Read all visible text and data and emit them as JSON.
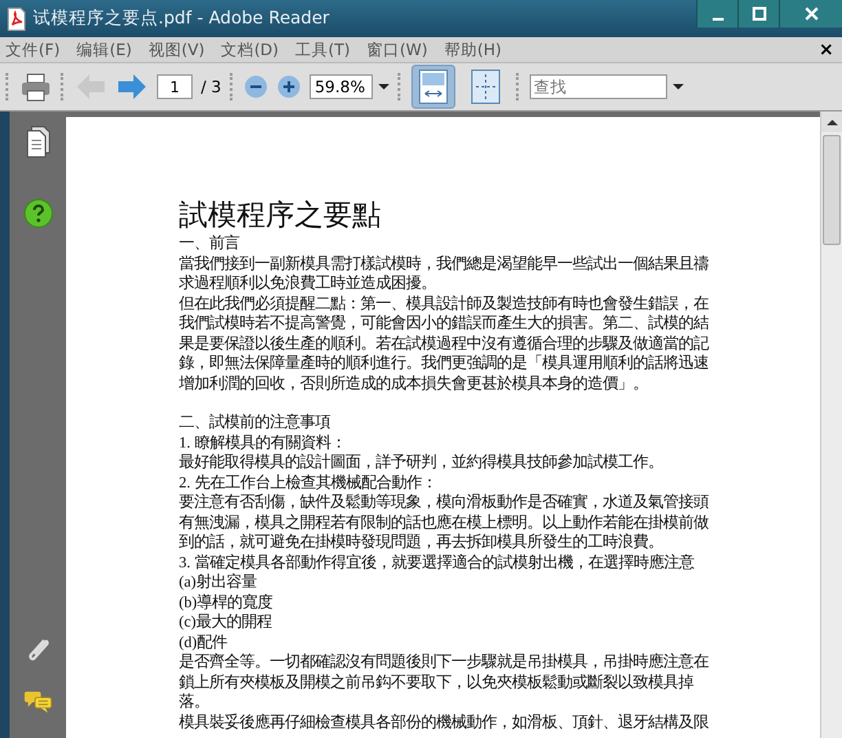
{
  "window": {
    "title": "试模程序之要点.pdf - Adobe Reader"
  },
  "menu": {
    "items": [
      "文件(F)",
      "编辑(E)",
      "视图(V)",
      "文档(D)",
      "工具(T)",
      "窗口(W)",
      "帮助(H)"
    ],
    "close": "×"
  },
  "toolbar": {
    "back_disabled": true,
    "page": "1",
    "page_total": "/ 3",
    "zoom": "59.8%",
    "view_buttons": [
      {
        "kind": "fit-width",
        "selected": true
      },
      {
        "kind": "fit-page",
        "selected": false
      }
    ],
    "search_placeholder": "查找"
  },
  "document": {
    "title": "試模程序之要點",
    "sections": [
      {
        "lines": [
          "一、前言",
          "當我們接到一副新模具需打樣試模時，我們總是渴望能早一些試出一個結果且禱",
          "求過程順利以免浪費工時並造成困擾。",
          "但在此我們必須提醒二點：第一、模具設計師及製造技師有時也會發生錯誤，在",
          "我們試模時若不提高警覺，可能會因小的錯誤而產生大的損害。第二、試模的結",
          "果是要保證以後生產的順利。若在試模過程中沒有遵循合理的步驟及做適當的記",
          "錄，即無法保障量產時的順利進行。我們更強調的是「模具運用順利的話將迅速",
          "增加利潤的回收，否則所造成的成本損失會更甚於模具本身的造價」。"
        ]
      },
      {
        "lines": [
          "二、試模前的注意事項",
          "1. 瞭解模具的有關資料：",
          "最好能取得模具的設計圖面，詳予研判，並約得模具技師參加試模工作。",
          "2. 先在工作台上檢查其機械配合動作：",
          "要注意有否刮傷，缺件及鬆動等現象，模向滑板動作是否確實，水道及氣管接頭",
          "有無洩漏，模具之開程若有限制的話也應在模上標明。以上動作若能在掛模前做",
          "到的話，就可避免在掛模時發現問題，再去拆卸模具所發生的工時浪費。",
          "3. 當確定模具各部動作得宜後，就要選擇適合的試模射出機，在選擇時應注意",
          "(a)射出容量",
          "(b)導桿的寬度",
          "(c)最大的開程",
          "(d)配件",
          "是否齊全等。一切都確認沒有問題後則下一步驟就是吊掛模具，吊掛時應注意在",
          "鎖上所有夾模板及開模之前吊鈎不要取下，以免夾模板鬆動或斷裂以致模具掉",
          "落。",
          "模具裝妥後應再仔細檢查模具各部份的機械動作，如滑板、頂針、退牙結構及限"
        ]
      }
    ]
  }
}
